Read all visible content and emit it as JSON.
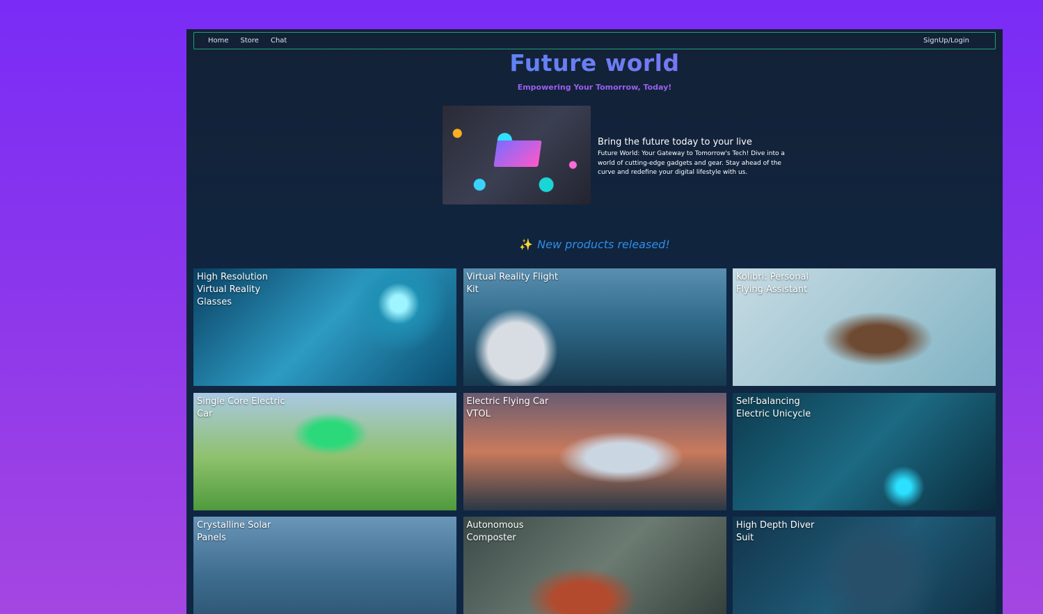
{
  "nav": {
    "links": [
      "Home",
      "Store",
      "Chat"
    ],
    "auth_label": "SignUp/Login"
  },
  "hero": {
    "title": "Future world",
    "subtitle": "Empowering Your Tomorrow, Today!",
    "heading": "Bring the future today to your live",
    "body": "Future World: Your Gateway to Tomorrow's Tech! Dive into a world of cutting-edge gadgets and gear. Stay ahead of the curve and redefine your digital lifestyle with us."
  },
  "new_products": {
    "icon": "sparkles-icon",
    "label": "New products released!"
  },
  "products": [
    "High Resolution Virtual Reality Glasses",
    "Virtual Reality Flight Kit",
    "Kolibri: Personal Flying Assistant",
    "Single Core Electric Car",
    "Electric Flying Car VTOL",
    "Self-balancing Electric Unicycle",
    "Crystalline Solar Panels",
    "Autonomous Composter",
    "High Depth Diver Suit"
  ]
}
